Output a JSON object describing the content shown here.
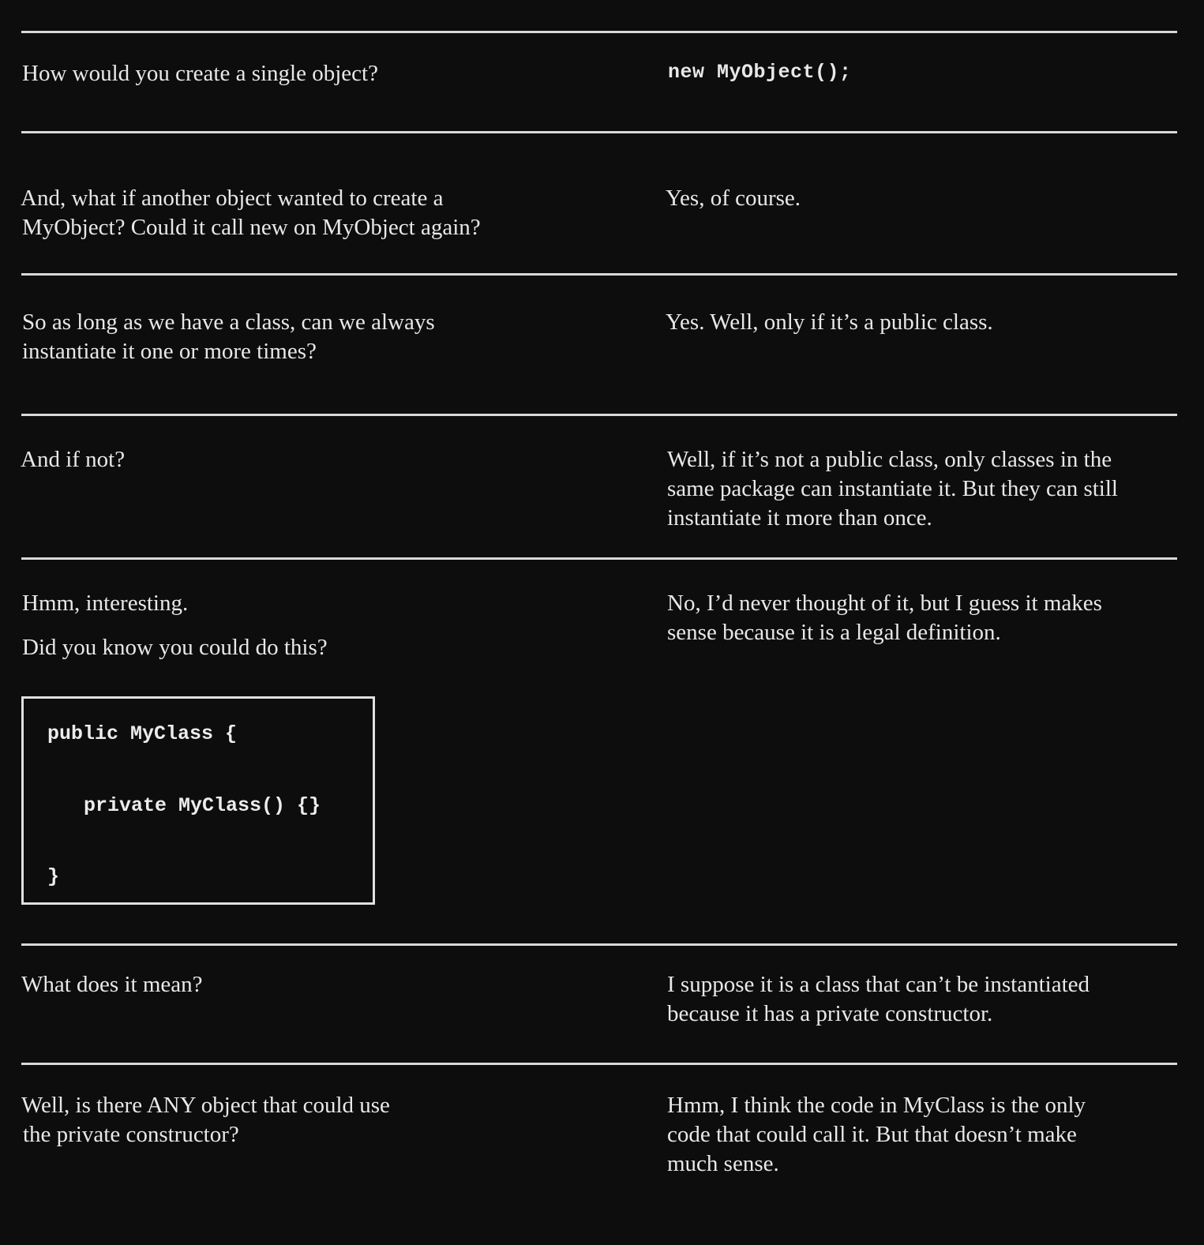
{
  "rows": [
    {
      "question": [
        "How would you create a single object?"
      ],
      "answer_code": "new MyObject();"
    },
    {
      "question": [
        "And, what if another object wanted to create a",
        "MyObject? Could it call new on MyObject again?"
      ],
      "answer": [
        "Yes, of course."
      ]
    },
    {
      "question": [
        "So as long as we have a class, can we always",
        "instantiate it one or more times?"
      ],
      "answer": [
        "Yes. Well, only if it’s a public class."
      ]
    },
    {
      "question": [
        "And if not?"
      ],
      "answer": [
        "Well, if it’s not a public class, only classes in the",
        "same package can instantiate it. But they can still",
        "instantiate it more than once."
      ]
    },
    {
      "question": [
        "Hmm, interesting.",
        "Did you know you could do this?"
      ],
      "answer": [
        "No, I’d never thought of it, but I guess it makes",
        "sense because it is a legal definition."
      ],
      "code_block": [
        "public MyClass {",
        "private MyClass() {}",
        "}"
      ]
    },
    {
      "question": [
        "What does it mean?"
      ],
      "answer": [
        "I suppose it is a class that can’t be instantiated",
        "because it has a private constructor."
      ]
    },
    {
      "question": [
        "Well, is there ANY object that could use",
        "the private constructor?"
      ],
      "answer": [
        "Hmm, I think the code in MyClass is the only",
        "code that could call it. But that doesn’t make",
        "much sense."
      ]
    }
  ]
}
